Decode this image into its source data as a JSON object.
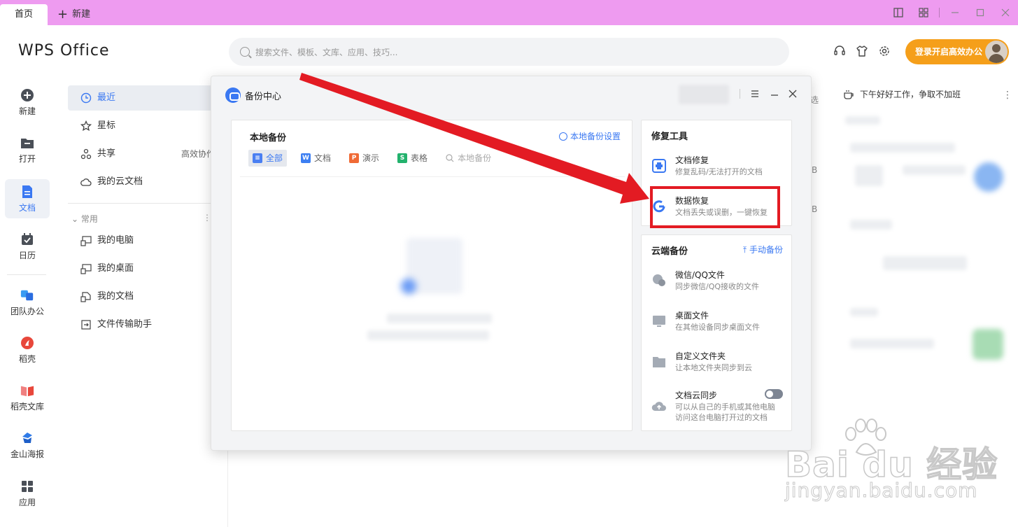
{
  "tabs": {
    "home": "首页",
    "new": "新建"
  },
  "header": {
    "logo": "WPS Office",
    "search_placeholder": "搜索文件、模板、文库、应用、技巧...",
    "login_button": "登录开启高效办公"
  },
  "leftnav": [
    {
      "label": "新建",
      "icon": "plus-circle-icon"
    },
    {
      "label": "打开",
      "icon": "folder-icon"
    },
    {
      "label": "文档",
      "icon": "document-icon",
      "active": true
    },
    {
      "label": "日历",
      "icon": "calendar-icon"
    },
    {
      "label": "团队办公",
      "icon": "team-icon"
    },
    {
      "label": "稻壳",
      "icon": "docer-icon"
    },
    {
      "label": "稻壳文库",
      "icon": "library-icon"
    },
    {
      "label": "金山海报",
      "icon": "poster-icon"
    },
    {
      "label": "应用",
      "icon": "apps-icon"
    }
  ],
  "sidebar": {
    "items": [
      {
        "label": "最近",
        "active": true
      },
      {
        "label": "星标"
      },
      {
        "label": "共享",
        "extra": "高效协作"
      },
      {
        "label": "我的云文档"
      }
    ],
    "common_header": "常用",
    "common_items": [
      {
        "label": "我的电脑"
      },
      {
        "label": "我的桌面"
      },
      {
        "label": "我的文档"
      },
      {
        "label": "文件传输助手"
      }
    ]
  },
  "background": {
    "greeting": "下午好好工作，争取不加班",
    "partial_select": "选",
    "size_suffix_1": "B",
    "size_suffix_2": "B"
  },
  "dialog": {
    "title": "备份中心",
    "local": {
      "title": "本地备份",
      "settings": "本地备份设置",
      "filters": [
        {
          "label": "全部",
          "active": true,
          "color": "#4a7ff2",
          "glyph": "≡"
        },
        {
          "label": "文档",
          "color": "#3d7ff2",
          "glyph": "W"
        },
        {
          "label": "演示",
          "color": "#f06a35",
          "glyph": "P"
        },
        {
          "label": "表格",
          "color": "#23b26d",
          "glyph": "S"
        }
      ],
      "search_placeholder": "本地备份"
    },
    "tools": {
      "title": "修复工具",
      "items": [
        {
          "name": "文档修复",
          "desc": "修复乱码/无法打开的文档"
        },
        {
          "name": "数据恢复",
          "desc": "文档丢失或误删，一键恢复"
        }
      ]
    },
    "cloud": {
      "title": "云端备份",
      "manual": "手动备份",
      "items": [
        {
          "name": "微信/QQ文件",
          "desc": "同步微信/QQ接收的文件"
        },
        {
          "name": "桌面文件",
          "desc": "在其他设备同步桌面文件"
        },
        {
          "name": "自定义文件夹",
          "desc": "让本地文件夹同步到云"
        },
        {
          "name": "文档云同步",
          "desc": "可以从自己的手机或其他电脑",
          "desc2": "访问这台电脑打开过的文档"
        }
      ]
    }
  },
  "watermark": {
    "brand": "Bai du 经验",
    "url": "jingyan.baidu.com"
  },
  "colors": {
    "accent": "#3a78f2",
    "tab_bar": "#ee9bf0",
    "login": "#f59f1a",
    "highlight": "#e31b23"
  }
}
